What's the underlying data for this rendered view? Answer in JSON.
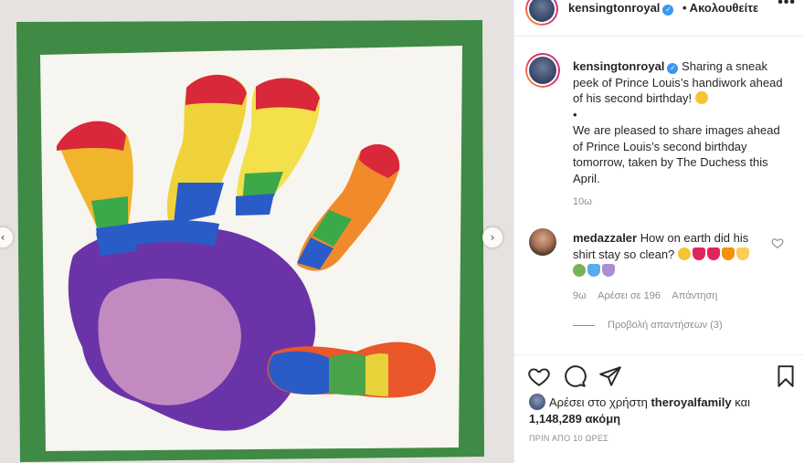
{
  "post": {
    "account": "kensingtonroyal",
    "follow_label": "• Ακολουθείτε",
    "more_label": "•••",
    "caption": {
      "line1": "Sharing a sneak peek of Prince Louis’s handiwork ahead of his second birthday!",
      "bullet": "•",
      "line2": "We are pleased to share images ahead of Prince Louis’s second birthday tomorrow, taken by The Duchess this April."
    },
    "time": "10ω"
  },
  "comment": {
    "username": "medazzaler",
    "text": "How on earth did his shirt stay so clean?",
    "emoji_colors_line1": [
      "#f4c530",
      "#e0245e",
      "#e0245e",
      "#f4900c",
      "#fdcb58"
    ],
    "emoji_colors_line2": [
      "#78b159",
      "#55acee",
      "#aa8ed6"
    ],
    "time": "9ω",
    "likes": "Αρέσει σε 196",
    "reply": "Απάντηση",
    "view_replies": "Προβολή απαντήσεων (3)"
  },
  "likes": {
    "prefix": "Αρέσει στο χρήστη",
    "user": "theroyalfamily",
    "and": "και",
    "count": "1,148,289 ακόμη"
  },
  "timestamp": "ΠΡΙΝ ΑΠΟ 10 ΩΡΕΣ",
  "icons": [
    "heart-icon",
    "comment-icon",
    "share-icon",
    "bookmark-icon",
    "chevron-left-icon",
    "chevron-right-icon",
    "verified-icon"
  ],
  "colors": {
    "accent_verified": "#3897f0",
    "muted": "#8e8e8e",
    "text": "#262626"
  }
}
